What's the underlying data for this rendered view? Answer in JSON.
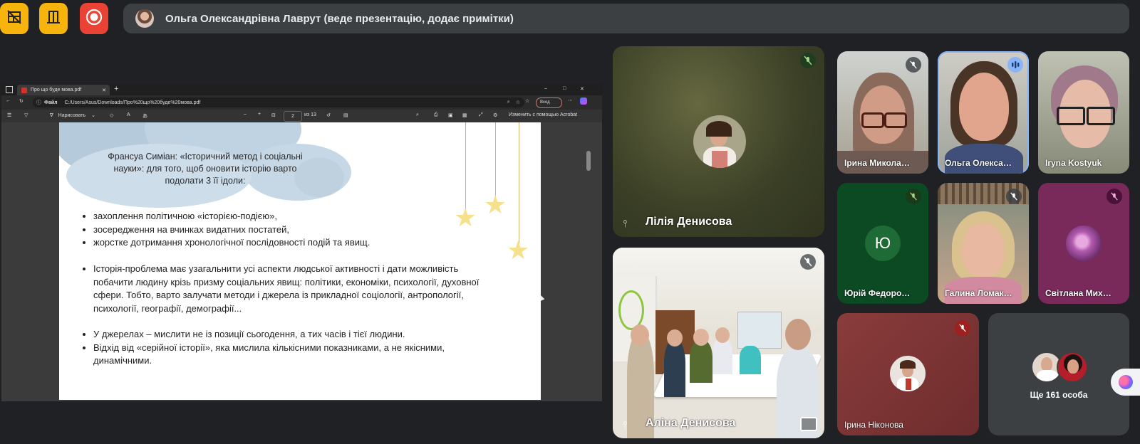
{
  "presenter_banner": {
    "text": "Ольга Олександрівна Лаврут (веде презентацію, додає примітки)"
  },
  "top_buttons": [
    {
      "name": "layout-off-icon",
      "color": "#f6b40c"
    },
    {
      "name": "door-exit-icon",
      "color": "#f6b40c"
    },
    {
      "name": "record-icon",
      "color": "#ea4335"
    }
  ],
  "browser": {
    "tab_title": "Про що буде мова.pdf",
    "new_tab": "+",
    "window_controls": [
      "–",
      "□",
      "✕"
    ],
    "file_label": "Файл",
    "url": "C:/Users/Asus/Downloads/Про%20що%20буде%20мова.pdf",
    "login_label": "Вход",
    "draw_label": "Нарисовать",
    "page_current": "2",
    "page_total": "из 13",
    "acrobat_label": "Изменить с помощью Acrobat"
  },
  "slide": {
    "title_line1_prefix": "Франсуа Симіан",
    "title_line1_rest": ": «Історичний метод і соціальні",
    "title_line2": "науки»: для того, щоб оновити історію варто",
    "title_line3": "подолати 3 її ідоли:",
    "bullets1": [
      "захоплення політичною «історією-подією»,",
      "зосередження на вчинках видатних постатей,",
      "жорстке дотримання хронологічної послідовності подій та явищ."
    ],
    "bullet2": "Історія-проблема має узагальнити усі аспекти людської активності і дати можливість побачити людину крізь призму соціальних явищ: політики, економіки, психології, духовної сфери. Тобто, варто залучати методи і джерела із прикладної соціології, антропології, психології, географії, демографії...",
    "bullets3": [
      "У джерелах – мислити не із позиції сьогодення, а тих часів і тієї людини.",
      "Відхід від «серійної історії», яка мислила кількісними показниками, а не якісними, динамічними."
    ]
  },
  "participants": {
    "lilia": "Лілія Денисова",
    "alina": "Аліна Денисова",
    "iryna_m": "Ірина Микола…",
    "olga": "Ольга Олекса…",
    "iryna_k": "Iryna Kostyuk",
    "yurii": "Юрій Федоро…",
    "yurii_initial": "Ю",
    "halyna": "Галина Ломак…",
    "svitlana": "Світлана Мих…",
    "iryna_n": "Ірина Ніконова",
    "more": "Ще 161 особа"
  },
  "colors": {
    "yellow": "#f6b40c",
    "red": "#ea4335",
    "speaking": "#8ab4f8"
  }
}
